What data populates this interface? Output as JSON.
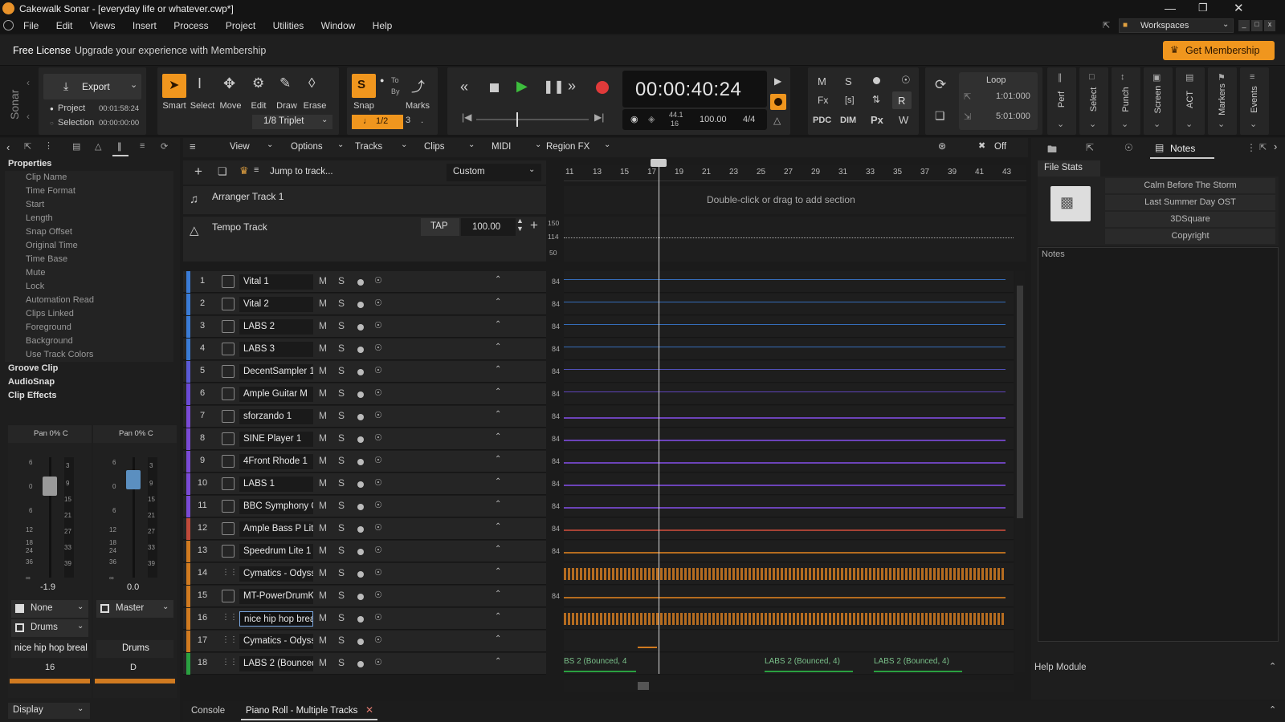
{
  "window": {
    "title": "Cakewalk Sonar - [everyday life or whatever.cwp*]"
  },
  "menu": [
    "File",
    "Edit",
    "Views",
    "Insert",
    "Process",
    "Project",
    "Utilities",
    "Window",
    "Help"
  ],
  "workspaces": {
    "label": "Workspaces"
  },
  "license": {
    "tag": "Free License",
    "message": "Upgrade your experience with Membership",
    "button": "Get Membership"
  },
  "brand": {
    "vertical": "Sonar"
  },
  "export": {
    "label": "Export",
    "project_label": "Project",
    "project_time": "00:01:58:24",
    "selection_label": "Selection",
    "selection_time": "00:00:00:00"
  },
  "tools": [
    {
      "label": "Smart",
      "icon": "smart-tool-icon"
    },
    {
      "label": "Select",
      "icon": "select-tool-icon"
    },
    {
      "label": "Move",
      "icon": "move-tool-icon"
    },
    {
      "label": "Edit",
      "icon": "edit-tool-icon"
    },
    {
      "label": "Draw",
      "icon": "draw-tool-icon"
    },
    {
      "label": "Erase",
      "icon": "erase-tool-icon"
    }
  ],
  "snap": {
    "label": "Snap",
    "to_label": "To",
    "by_label": "By",
    "marks_label": "Marks",
    "value": "1/8 Triplet",
    "note_value": "1/2",
    "count": "3"
  },
  "transport": {
    "time": "00:00:40:24",
    "sample_rate": "44.1",
    "bit_depth": "16",
    "tempo": "100.00",
    "meter": "4/4"
  },
  "mix": {
    "m": "M",
    "s": "S",
    "pdc": "PDC",
    "dim": "DIM",
    "px": "Px",
    "r": "R",
    "fx": "Fx",
    "sbr": "[s]"
  },
  "loop": {
    "label": "Loop",
    "start": "1:01:000",
    "end": "5:01:000"
  },
  "side_modules": [
    "Perf",
    "Select",
    "Punch",
    "Screen",
    "ACT",
    "Markers",
    "Events"
  ],
  "inspector": {
    "header": "Properties",
    "items": [
      "Clip Name",
      "Time Format",
      "Start",
      "Length",
      "Snap Offset",
      "Original Time",
      "Time Base",
      "Mute",
      "Lock",
      "Automation Read",
      "Clips Linked",
      "Foreground",
      "Background",
      "Use Track Colors"
    ],
    "sections": [
      "Groove Clip",
      "AudioSnap",
      "Clip Effects"
    ]
  },
  "strips": [
    {
      "pan": "Pan 0% C",
      "vol": "-1.9",
      "input": "None",
      "output": "Drums",
      "name": "nice hip hop breal",
      "number": "16"
    },
    {
      "pan": "Pan 0% C",
      "vol": "0.0",
      "input": "Master",
      "output": "",
      "name": "Drums",
      "number": "D"
    }
  ],
  "fader_scale": [
    "6",
    "0",
    "6",
    "12",
    "18",
    "24",
    "36",
    "∞"
  ],
  "meter_scale": [
    "3",
    "9",
    "15",
    "21",
    "27",
    "33",
    "39"
  ],
  "display_label": "Display",
  "track_view": {
    "menus": [
      "View",
      "Options",
      "Tracks",
      "Clips",
      "MIDI",
      "Region FX"
    ],
    "jump": "Jump to track...",
    "preset": "Custom",
    "off_label": "Off",
    "ruler": [
      "11",
      "13",
      "15",
      "17",
      "19",
      "21",
      "23",
      "25",
      "27",
      "29",
      "31",
      "33",
      "35",
      "37",
      "39",
      "41",
      "43"
    ],
    "arranger_name": "Arranger Track 1",
    "arranger_hint": "Double-click or drag to add section",
    "tempo_name": "Tempo Track",
    "tap": "TAP",
    "tempo_value": "100.00",
    "tempo_scale": [
      "150",
      "114",
      "50"
    ]
  },
  "tracks": [
    {
      "num": "1",
      "name": "Vital 1",
      "type": "midi",
      "vol": "84",
      "color": "#3a7bd5"
    },
    {
      "num": "2",
      "name": "Vital 2",
      "type": "midi",
      "vol": "84",
      "color": "#3a7bd5"
    },
    {
      "num": "3",
      "name": "LABS 2",
      "type": "midi",
      "vol": "84",
      "color": "#3a7bd5"
    },
    {
      "num": "4",
      "name": "LABS 3",
      "type": "midi",
      "vol": "84",
      "color": "#3a7bd5"
    },
    {
      "num": "5",
      "name": "DecentSampler 1",
      "type": "midi",
      "vol": "84",
      "color": "#5a5ad5"
    },
    {
      "num": "6",
      "name": "Ample Guitar M",
      "type": "midi",
      "vol": "84",
      "color": "#6a4ad5"
    },
    {
      "num": "7",
      "name": "sforzando 1",
      "type": "midi",
      "vol": "84",
      "color": "#7a4ad5"
    },
    {
      "num": "8",
      "name": "SINE Player 1",
      "type": "midi",
      "vol": "84",
      "color": "#7a4ad5"
    },
    {
      "num": "9",
      "name": "4Front Rhode 1",
      "type": "midi",
      "vol": "84",
      "color": "#7a4ad5"
    },
    {
      "num": "10",
      "name": "LABS 1",
      "type": "midi",
      "vol": "84",
      "color": "#7a4ad5"
    },
    {
      "num": "11",
      "name": "BBC Symphony O",
      "type": "midi",
      "vol": "84",
      "color": "#7a4ad5"
    },
    {
      "num": "12",
      "name": "Ample Bass P Lite",
      "type": "midi",
      "vol": "84",
      "color": "#c04a3a"
    },
    {
      "num": "13",
      "name": "Speedrum Lite 1",
      "type": "midi",
      "vol": "84",
      "color": "#d07a20"
    },
    {
      "num": "14",
      "name": "Cymatics - Odyss",
      "type": "audio",
      "vol": "",
      "color": "#d07a20"
    },
    {
      "num": "15",
      "name": "MT-PowerDrumK",
      "type": "midi",
      "vol": "84",
      "color": "#d07a20"
    },
    {
      "num": "16",
      "name": "nice hip hop brea",
      "type": "audio",
      "vol": "",
      "color": "#d07a20"
    },
    {
      "num": "17",
      "name": "Cymatics - Odyss",
      "type": "audio",
      "vol": "",
      "color": "#d07a20"
    },
    {
      "num": "18",
      "name": "LABS 2 (Bounced,",
      "type": "audio",
      "vol": "",
      "color": "#2aa040"
    }
  ],
  "clip_labels": {
    "a": "BS 2 (Bounced, 4",
    "b": "LABS 2 (Bounced, 4)",
    "c": "LABS 2 (Bounced, 4)"
  },
  "browser": {
    "tab": "Notes",
    "file_stats": "File Stats",
    "fields": [
      "Calm Before The Storm",
      "Last Summer Day OST",
      "3DSquare",
      "Copyright"
    ],
    "notes_label": "Notes",
    "help": "Help Module"
  },
  "bottom_tabs": [
    "Console",
    "Piano Roll - Multiple Tracks"
  ],
  "colors": {
    "accent": "#f0961e",
    "play": "#3dbe3d",
    "record": "#e03a3a"
  }
}
